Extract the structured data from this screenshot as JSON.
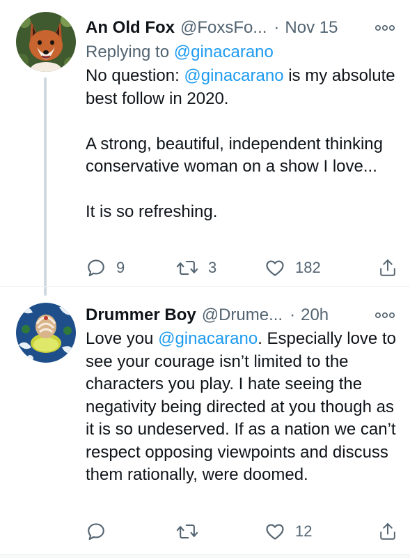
{
  "tweets": [
    {
      "author_name": "An Old Fox",
      "handle": "@FoxsFo...",
      "separator": "·",
      "date": "Nov 15",
      "replying_prefix": "Replying to ",
      "replying_handle": "@ginacarano",
      "body_lead": "No question: ",
      "body_mention": "@ginacarano",
      "body_rest": " is my absolute best follow in 2020.\n\nA strong, beautiful, independent thinking conservative woman on a show I love...\n\nIt is so refreshing.",
      "reply_count": "9",
      "retweet_count": "3",
      "like_count": "182",
      "avatar_icon": "fox-avatar"
    },
    {
      "author_name": "Drummer Boy",
      "handle": "@Drume...",
      "separator": "·",
      "date": "20h",
      "body_lead": "Love you ",
      "body_mention": "@ginacarano",
      "body_rest": ".  Especially love to see your courage isn’t limited to the characters you play.  I hate seeing the negativity being directed at you though  as it is so undeserved.  If as a nation we can’t respect opposing viewpoints and discuss them rationally, were doomed.",
      "reply_count": "",
      "retweet_count": "",
      "like_count": "12",
      "avatar_icon": "hawaiian-floral-avatar"
    }
  ],
  "colors": {
    "link": "#1d9bf0",
    "secondary_text": "#536471",
    "primary_text": "#0f1419",
    "thread_line": "#cfd9de"
  },
  "icons": [
    "more-icon",
    "reply-icon",
    "retweet-icon",
    "like-icon",
    "share-icon"
  ]
}
